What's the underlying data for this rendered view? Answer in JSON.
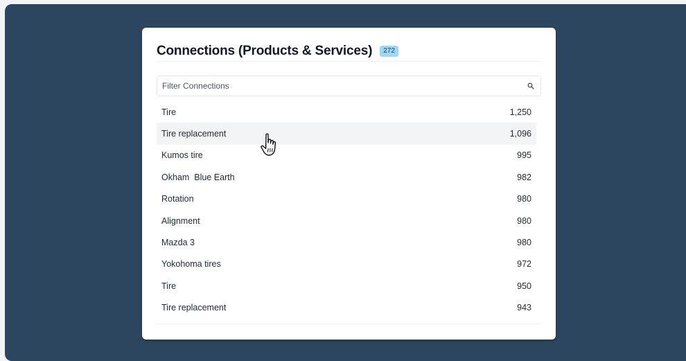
{
  "panel": {
    "title": "Connections (Products & Services)",
    "count": "272"
  },
  "search": {
    "placeholder": "Filter Connections",
    "icon": "search-icon"
  },
  "rows": [
    {
      "label": "Tire",
      "value": "1,250"
    },
    {
      "label": "Tire replacement",
      "value": "1,096",
      "hovered": true
    },
    {
      "label": "Kumos tire",
      "value": "995"
    },
    {
      "label": "Okham  Blue Earth",
      "value": "982"
    },
    {
      "label": "Rotation",
      "value": "980"
    },
    {
      "label": "Alignment",
      "value": "980"
    },
    {
      "label": "Mazda 3",
      "value": "980"
    },
    {
      "label": "Yokohoma tires",
      "value": "972"
    },
    {
      "label": "Tire",
      "value": "950"
    },
    {
      "label": "Tire replacement",
      "value": "943"
    }
  ],
  "cursor": {
    "icon": "hand-pointer-icon"
  },
  "colors": {
    "backdrop": "#2c4660",
    "badge": "#9ed8f5",
    "row_hover": "#f3f4f6"
  }
}
